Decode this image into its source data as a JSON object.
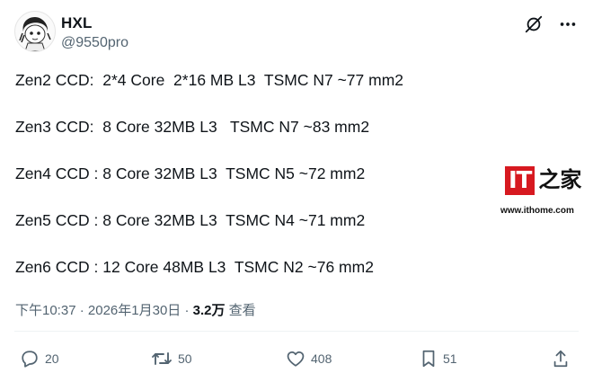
{
  "author": {
    "name": "HXL",
    "handle": "@9550pro"
  },
  "post": {
    "lines": [
      "Zen2 CCD:  2*4 Core  2*16 MB L3  TSMC N7 ~77 mm2",
      "Zen3 CCD:  8 Core 32MB L3   TSMC N7 ~83 mm2",
      "Zen4 CCD : 8 Core 32MB L3  TSMC N5 ~72 mm2",
      "Zen5 CCD : 8 Core 32MB L3  TSMC N4 ~71 mm2",
      "Zen6 CCD : 12 Core 48MB L3  TSMC N2 ~76 mm2"
    ]
  },
  "meta": {
    "time": "下午10:37",
    "date": "2026年1月30日",
    "separator": " · ",
    "views_count": "3.2万",
    "views_label": "查看"
  },
  "actions": {
    "replies": "20",
    "reposts": "50",
    "likes": "408",
    "bookmarks": "51"
  },
  "header_icons": [
    "grok-icon",
    "more-icon"
  ],
  "watermark": {
    "logo_text": "IT",
    "logo_zh": "之家",
    "url": "www.ithome.com"
  },
  "colors": {
    "text": "#0f1419",
    "secondary": "#536471",
    "brand_red": "#d71920"
  }
}
